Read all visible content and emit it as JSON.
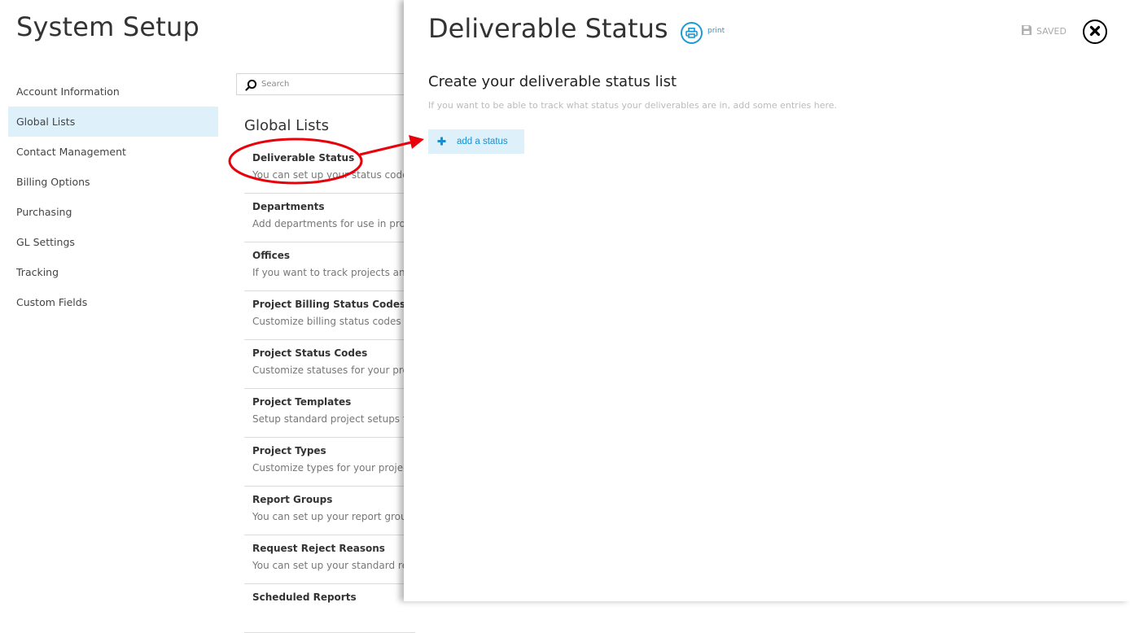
{
  "app": {
    "title": "System Setup"
  },
  "sidebar": {
    "items": [
      {
        "label": "Account Information"
      },
      {
        "label": "Global Lists",
        "active": true
      },
      {
        "label": "Contact Management"
      },
      {
        "label": "Billing Options"
      },
      {
        "label": "Purchasing"
      },
      {
        "label": "GL Settings"
      },
      {
        "label": "Tracking"
      },
      {
        "label": "Custom Fields"
      }
    ]
  },
  "search": {
    "placeholder": "Search",
    "icon": "search-icon"
  },
  "global_lists": {
    "heading": "Global Lists",
    "items": [
      {
        "title": "Deliverable Status",
        "desc": "You can set up your status codes"
      },
      {
        "title": "Departments",
        "desc": "Add departments for use in proje"
      },
      {
        "title": "Offices",
        "desc": "If you want to track projects and f"
      },
      {
        "title": "Project Billing Status Codes",
        "desc": "Customize billing status codes for"
      },
      {
        "title": "Project Status Codes",
        "desc": "Customize statuses for your proje"
      },
      {
        "title": "Project Templates",
        "desc": "Setup standard project setups to"
      },
      {
        "title": "Project Types",
        "desc": "Customize types for your projects"
      },
      {
        "title": "Report Groups",
        "desc": "You can set up your report group"
      },
      {
        "title": "Request Reject Reasons",
        "desc": "You can set up your standard rea"
      },
      {
        "title": "Scheduled Reports",
        "desc": ""
      }
    ]
  },
  "panel": {
    "title": "Deliverable Status",
    "print_label": "print",
    "saved_label": "SAVED",
    "section_heading": "Create your deliverable status list",
    "section_hint": "If you want to be able to track what status your deliverables are in, add some entries here.",
    "add_button_label": "add a status"
  },
  "colors": {
    "accent": "#1a9ad6",
    "active_bg": "#def0fa",
    "annotation": "#e8000b"
  }
}
